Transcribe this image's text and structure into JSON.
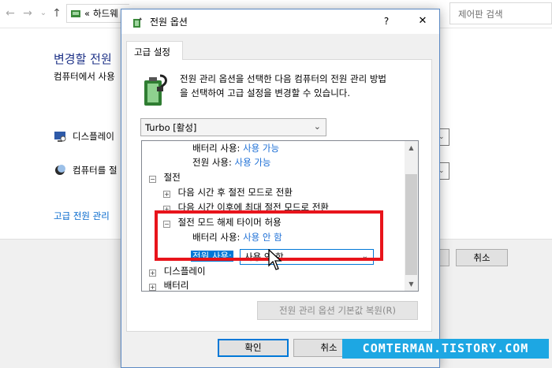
{
  "background": {
    "breadcrumb": "하드웨",
    "breadcrumb_sep": "«",
    "search_placeholder": "제어판 검색",
    "page_title": "변경할 전원",
    "description": "컴퓨터에서 사용",
    "rows": [
      "디스플레이",
      "컴퓨터를 절"
    ],
    "link": "고급 전원 관리",
    "cancel_button": "취소"
  },
  "dialog": {
    "title": "전원 옵션",
    "help_glyph": "?",
    "close_glyph": "✕",
    "tab_label": "고급 설정",
    "intro_text": "전원 관리 옵션을 선택한 다음 컴퓨터의 전원 관리 방법\n을 선택하여 고급 설정을 변경할 수 있습니다.",
    "plan_selected": "Turbo [활성]",
    "tree": {
      "battery_label": "배터리 사용:",
      "plugged_label": "전원 사용:",
      "enabled_value": "사용 가능",
      "sleep": "절전",
      "sleep_after_hybrid": "다음 시간 후 절전 모드로 전환",
      "hibernate_after": "다음 시간 이후에 최대 절전 모드로 전환",
      "wake_timers": "절전 모드 해제 타이머 허용",
      "wake_battery_value": "사용 안 함",
      "wake_plugged_value": "사용 안 함",
      "display": "디스플레이",
      "battery": "배터리",
      "collapse_glyph": "⊟",
      "expand_glyph": "⊞"
    },
    "restore_button": "전원 관리 옵션 기본값 복원(R)",
    "ok_button": "확인",
    "cancel_button": "취소"
  },
  "watermark": "COMTERMAN.TISTORY.COM",
  "colors": {
    "accent": "#0078d7",
    "highlight": "#e8141b",
    "link": "#1d6fd6",
    "watermark": "#1da7e3"
  }
}
